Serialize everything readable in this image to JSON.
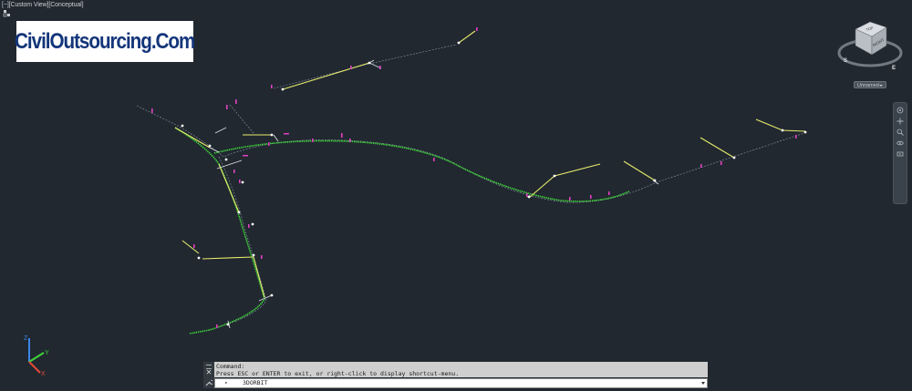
{
  "viewport": {
    "label": "[−][Custom View][Conceptual]"
  },
  "watermark": {
    "text": "CivilOutsourcing.Com"
  },
  "viewcube": {
    "top_face": "TOP",
    "right_face": "RIGHT",
    "compass_s": "S",
    "compass_e": "E",
    "named_view": "Unnamed"
  },
  "ucs": {
    "x": "X",
    "y": "Y",
    "z": "Z"
  },
  "command_line": {
    "history_line1": "Command:",
    "history_line2": "Press ESC or ENTER to exit, or right-click to display shortcut-menu.",
    "current_command": "3DORBIT"
  },
  "colors": {
    "background": "#212830",
    "alignment_green": "#3fd43a",
    "profile_yellow": "#e8ec6a",
    "marker_magenta": "#e040c0",
    "thin_line": "#8a96a8"
  }
}
